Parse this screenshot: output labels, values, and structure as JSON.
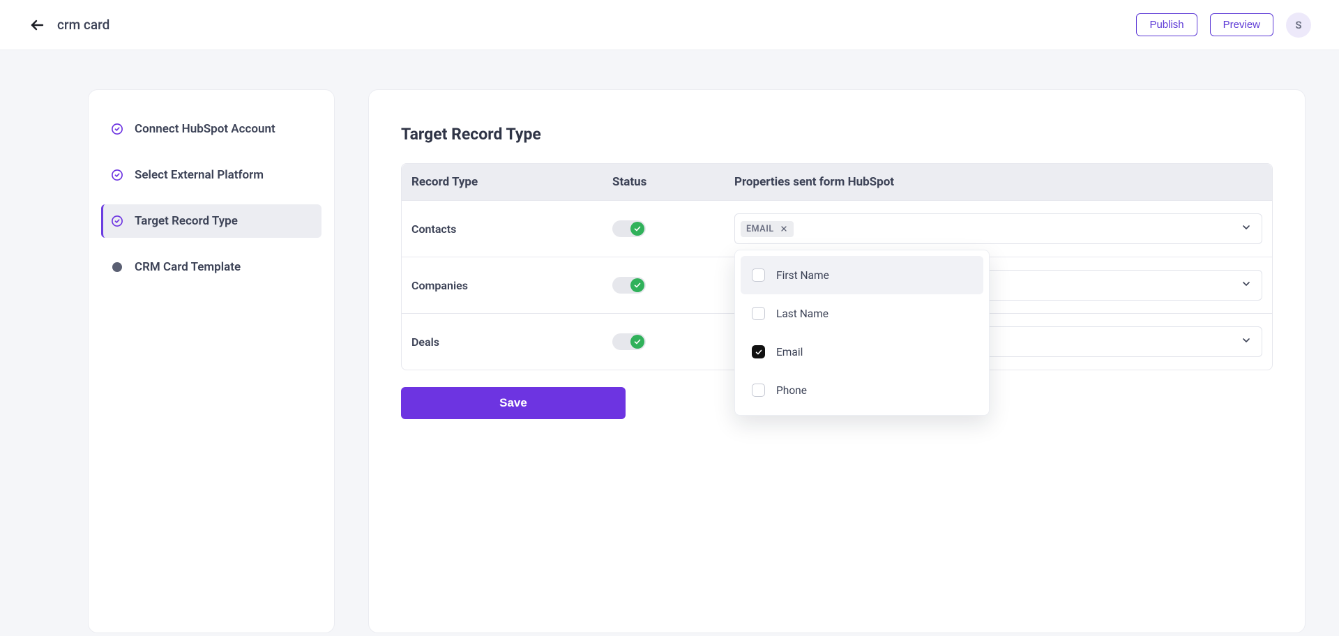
{
  "header": {
    "title": "crm card",
    "publish": "Publish",
    "preview": "Preview",
    "avatar_initial": "S"
  },
  "sidebar": {
    "steps": [
      {
        "label": "Connect HubSpot Account",
        "state": "done"
      },
      {
        "label": "Select External Platform",
        "state": "done"
      },
      {
        "label": "Target Record Type",
        "state": "active"
      },
      {
        "label": "CRM Card Template",
        "state": "pending"
      }
    ]
  },
  "main": {
    "heading": "Target Record Type",
    "columns": {
      "record_type": "Record Type",
      "status": "Status",
      "properties": "Properties sent form HubSpot"
    },
    "rows": [
      {
        "name": "Contacts",
        "enabled": true,
        "chips": [
          "EMAIL"
        ],
        "dropdown_open": true
      },
      {
        "name": "Companies",
        "enabled": true,
        "chips": []
      },
      {
        "name": "Deals",
        "enabled": true,
        "chips": []
      }
    ],
    "dropdown_options": [
      {
        "label": "First Name",
        "checked": false,
        "hover": true
      },
      {
        "label": "Last Name",
        "checked": false,
        "hover": false
      },
      {
        "label": "Email",
        "checked": true,
        "hover": false
      },
      {
        "label": "Phone",
        "checked": false,
        "hover": false
      }
    ],
    "save_label": "Save"
  }
}
